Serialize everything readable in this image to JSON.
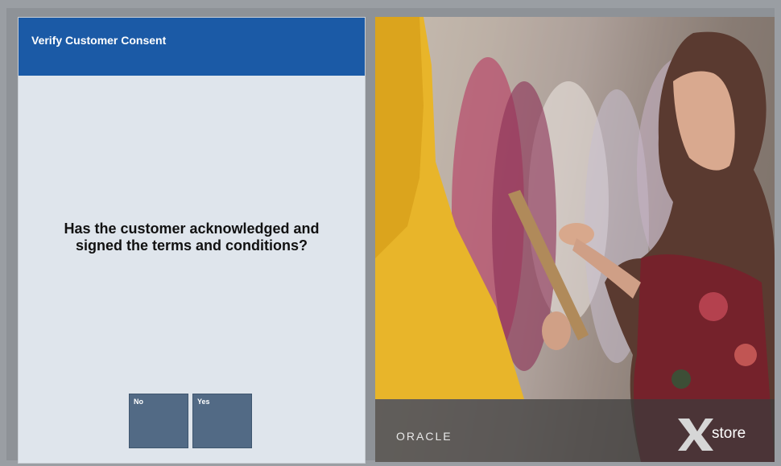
{
  "dialog": {
    "title": "Verify Customer Consent",
    "question_line1": "Has the customer acknowledged and",
    "question_line2": "signed the terms and conditions?",
    "buttons": [
      {
        "label": "No"
      },
      {
        "label": "Yes"
      }
    ]
  },
  "branding": {
    "oracle_logo": "ORACLE",
    "xstore_logo": "store"
  },
  "colors": {
    "header_blue": "#1b5aa6",
    "panel_bg": "#dfe5ec",
    "button_bg": "#526a85"
  }
}
